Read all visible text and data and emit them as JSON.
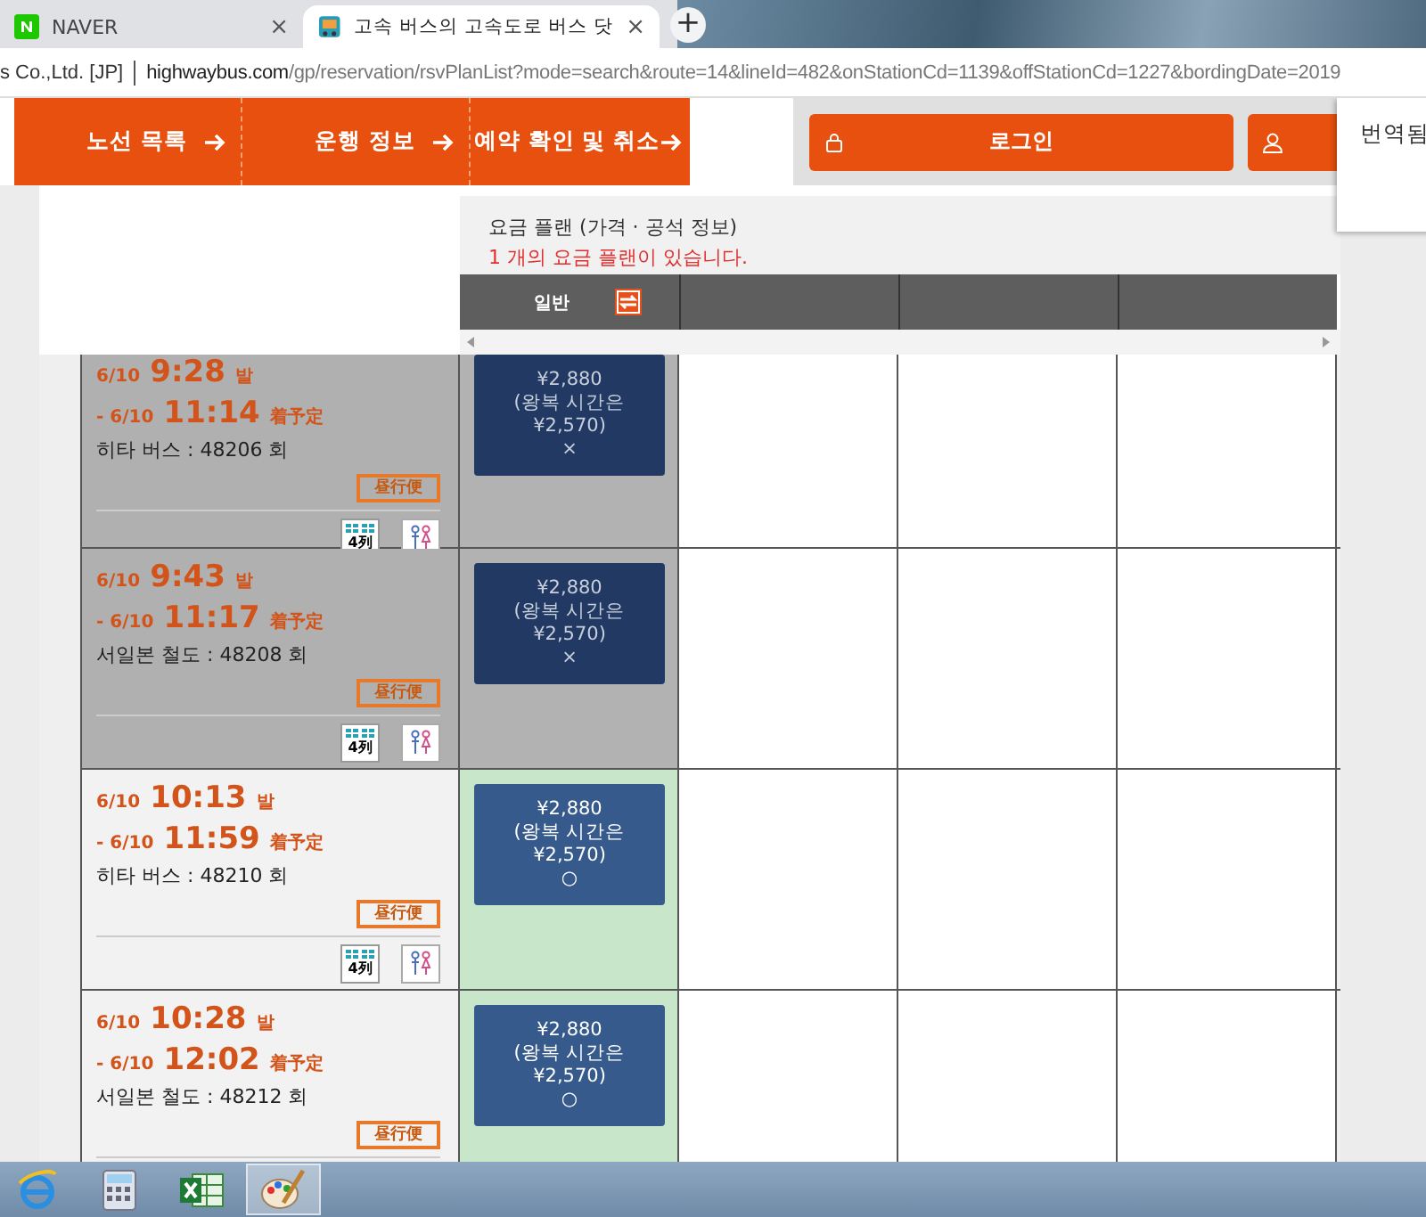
{
  "browser": {
    "tabs": [
      {
        "title": "NAVER",
        "selected": false,
        "close": "×"
      },
      {
        "title": "고속 버스의 고속도로 버스 닷",
        "selected": true,
        "close": "×"
      }
    ],
    "new_tab": "+",
    "address": {
      "site_name": "s Co.,Ltd. [JP]",
      "domain": "highwaybus.com",
      "path": "/gp/reservation/rsvPlanList?mode=search&route=14&lineId=482&onStationCd=1139&offStationCd=1227&bordingDate=2019"
    }
  },
  "nav": [
    {
      "label": "노선 목록"
    },
    {
      "label": "운행 정보"
    },
    {
      "label": "예약 확인 및 취소"
    }
  ],
  "login_button": "로그인",
  "translate_popup": "번역됨",
  "plans": {
    "title": "요금 플랜 (가격 · 공석 정보)",
    "count_note": "1 개의 요금 플랜이 있습니다.",
    "columns": [
      "일반"
    ]
  },
  "trips": [
    {
      "dep_date": "6/10",
      "dep_time": "9:28",
      "dep_suffix": "발",
      "arr_prefix": "- 6/10",
      "arr_time": "11:14",
      "arr_suffix": "着予定",
      "operator": "히타 버스 : 48206 회",
      "badge": "昼行便",
      "seat_label": "4列",
      "available": false,
      "price": "¥2,880",
      "note": "(왕복 시간은",
      "return_price": "¥2,570)",
      "mark": "×"
    },
    {
      "dep_date": "6/10",
      "dep_time": "9:43",
      "dep_suffix": "발",
      "arr_prefix": "- 6/10",
      "arr_time": "11:17",
      "arr_suffix": "着予定",
      "operator": "서일본 철도 : 48208 회",
      "badge": "昼行便",
      "seat_label": "4列",
      "available": false,
      "price": "¥2,880",
      "note": "(왕복 시간은",
      "return_price": "¥2,570)",
      "mark": "×"
    },
    {
      "dep_date": "6/10",
      "dep_time": "10:13",
      "dep_suffix": "발",
      "arr_prefix": "- 6/10",
      "arr_time": "11:59",
      "arr_suffix": "着予定",
      "operator": "히타 버스 : 48210 회",
      "badge": "昼行便",
      "seat_label": "4列",
      "available": true,
      "price": "¥2,880",
      "note": "(왕복 시간은",
      "return_price": "¥2,570)",
      "mark": "○"
    },
    {
      "dep_date": "6/10",
      "dep_time": "10:28",
      "dep_suffix": "발",
      "arr_prefix": "- 6/10",
      "arr_time": "12:02",
      "arr_suffix": "着予定",
      "operator": "서일본 철도 : 48212 회",
      "badge": "昼行便",
      "available": true,
      "price": "¥2,880",
      "note": "(왕복 시간은",
      "return_price": "¥2,570)",
      "mark": "○"
    }
  ],
  "taskbar": [
    {
      "kind": "browser",
      "selected": false
    },
    {
      "kind": "calculator",
      "selected": false
    },
    {
      "kind": "spreadsheet",
      "selected": false
    },
    {
      "kind": "paint",
      "selected": true
    }
  ]
}
